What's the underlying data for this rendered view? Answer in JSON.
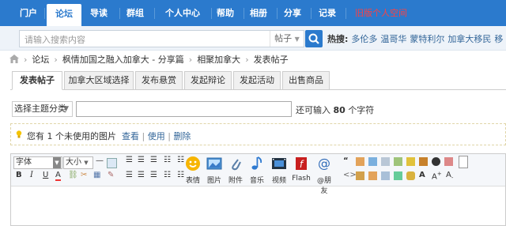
{
  "nav": {
    "items": [
      "门户",
      "论坛",
      "导读",
      "群组",
      "个人中心",
      "帮助",
      "相册",
      "分享",
      "记录"
    ],
    "old_space": "旧版个人空间",
    "active_index": 1
  },
  "search": {
    "placeholder": "请输入搜索内容",
    "scope": "帖子",
    "hot_label": "热搜:",
    "hot_items": [
      "多伦多",
      "温哥华",
      "蒙特利尔",
      "加拿大移民",
      "移"
    ]
  },
  "breadcrumb": [
    "论坛",
    "枫情加国之融入加拿大 - 分享篇",
    "相聚加拿大",
    "发表帖子"
  ],
  "tabs": [
    "发表帖子",
    "加拿大区域选择",
    "发布悬赏",
    "发起辩论",
    "发起活动",
    "出售商品"
  ],
  "form": {
    "category_select": "选择主题分类",
    "remain_prefix": "还可输入",
    "remain_count": "80",
    "remain_suffix": "个字符"
  },
  "notice": {
    "text": "您有 1 个未使用的图片",
    "view": "查看",
    "use": "使用",
    "delete": "删除",
    "sep": "|"
  },
  "editor": {
    "font_family": "字体",
    "font_size": "大小",
    "big_buttons": [
      "表情",
      "图片",
      "附件",
      "音乐",
      "视频",
      "Flash",
      "@朋友"
    ]
  },
  "colors": {
    "nav_bg": "#2b7acd",
    "link": "#336699",
    "old_space": "#ff4040"
  }
}
